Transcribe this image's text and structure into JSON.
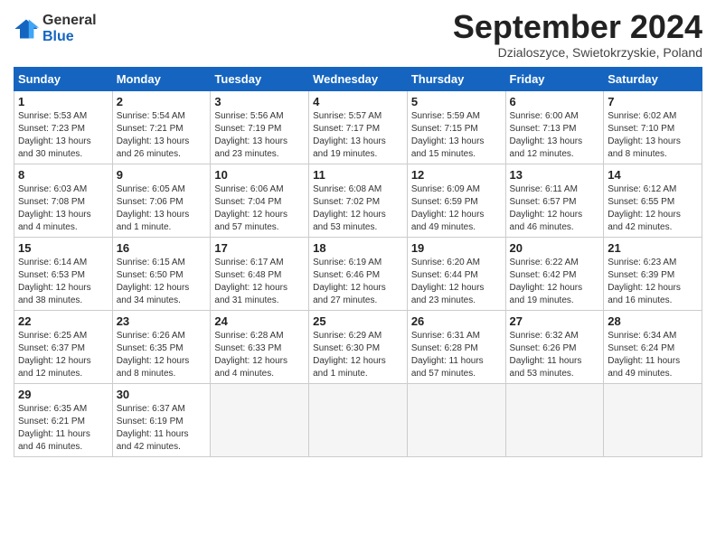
{
  "logo": {
    "general": "General",
    "blue": "Blue"
  },
  "title": "September 2024",
  "subtitle": "Dzialoszyce, Swietokrzyskie, Poland",
  "days_header": [
    "Sunday",
    "Monday",
    "Tuesday",
    "Wednesday",
    "Thursday",
    "Friday",
    "Saturday"
  ],
  "weeks": [
    [
      {
        "day": "1",
        "info": "Sunrise: 5:53 AM\nSunset: 7:23 PM\nDaylight: 13 hours\nand 30 minutes."
      },
      {
        "day": "2",
        "info": "Sunrise: 5:54 AM\nSunset: 7:21 PM\nDaylight: 13 hours\nand 26 minutes."
      },
      {
        "day": "3",
        "info": "Sunrise: 5:56 AM\nSunset: 7:19 PM\nDaylight: 13 hours\nand 23 minutes."
      },
      {
        "day": "4",
        "info": "Sunrise: 5:57 AM\nSunset: 7:17 PM\nDaylight: 13 hours\nand 19 minutes."
      },
      {
        "day": "5",
        "info": "Sunrise: 5:59 AM\nSunset: 7:15 PM\nDaylight: 13 hours\nand 15 minutes."
      },
      {
        "day": "6",
        "info": "Sunrise: 6:00 AM\nSunset: 7:13 PM\nDaylight: 13 hours\nand 12 minutes."
      },
      {
        "day": "7",
        "info": "Sunrise: 6:02 AM\nSunset: 7:10 PM\nDaylight: 13 hours\nand 8 minutes."
      }
    ],
    [
      {
        "day": "8",
        "info": "Sunrise: 6:03 AM\nSunset: 7:08 PM\nDaylight: 13 hours\nand 4 minutes."
      },
      {
        "day": "9",
        "info": "Sunrise: 6:05 AM\nSunset: 7:06 PM\nDaylight: 13 hours\nand 1 minute."
      },
      {
        "day": "10",
        "info": "Sunrise: 6:06 AM\nSunset: 7:04 PM\nDaylight: 12 hours\nand 57 minutes."
      },
      {
        "day": "11",
        "info": "Sunrise: 6:08 AM\nSunset: 7:02 PM\nDaylight: 12 hours\nand 53 minutes."
      },
      {
        "day": "12",
        "info": "Sunrise: 6:09 AM\nSunset: 6:59 PM\nDaylight: 12 hours\nand 49 minutes."
      },
      {
        "day": "13",
        "info": "Sunrise: 6:11 AM\nSunset: 6:57 PM\nDaylight: 12 hours\nand 46 minutes."
      },
      {
        "day": "14",
        "info": "Sunrise: 6:12 AM\nSunset: 6:55 PM\nDaylight: 12 hours\nand 42 minutes."
      }
    ],
    [
      {
        "day": "15",
        "info": "Sunrise: 6:14 AM\nSunset: 6:53 PM\nDaylight: 12 hours\nand 38 minutes."
      },
      {
        "day": "16",
        "info": "Sunrise: 6:15 AM\nSunset: 6:50 PM\nDaylight: 12 hours\nand 34 minutes."
      },
      {
        "day": "17",
        "info": "Sunrise: 6:17 AM\nSunset: 6:48 PM\nDaylight: 12 hours\nand 31 minutes."
      },
      {
        "day": "18",
        "info": "Sunrise: 6:19 AM\nSunset: 6:46 PM\nDaylight: 12 hours\nand 27 minutes."
      },
      {
        "day": "19",
        "info": "Sunrise: 6:20 AM\nSunset: 6:44 PM\nDaylight: 12 hours\nand 23 minutes."
      },
      {
        "day": "20",
        "info": "Sunrise: 6:22 AM\nSunset: 6:42 PM\nDaylight: 12 hours\nand 19 minutes."
      },
      {
        "day": "21",
        "info": "Sunrise: 6:23 AM\nSunset: 6:39 PM\nDaylight: 12 hours\nand 16 minutes."
      }
    ],
    [
      {
        "day": "22",
        "info": "Sunrise: 6:25 AM\nSunset: 6:37 PM\nDaylight: 12 hours\nand 12 minutes."
      },
      {
        "day": "23",
        "info": "Sunrise: 6:26 AM\nSunset: 6:35 PM\nDaylight: 12 hours\nand 8 minutes."
      },
      {
        "day": "24",
        "info": "Sunrise: 6:28 AM\nSunset: 6:33 PM\nDaylight: 12 hours\nand 4 minutes."
      },
      {
        "day": "25",
        "info": "Sunrise: 6:29 AM\nSunset: 6:30 PM\nDaylight: 12 hours\nand 1 minute."
      },
      {
        "day": "26",
        "info": "Sunrise: 6:31 AM\nSunset: 6:28 PM\nDaylight: 11 hours\nand 57 minutes."
      },
      {
        "day": "27",
        "info": "Sunrise: 6:32 AM\nSunset: 6:26 PM\nDaylight: 11 hours\nand 53 minutes."
      },
      {
        "day": "28",
        "info": "Sunrise: 6:34 AM\nSunset: 6:24 PM\nDaylight: 11 hours\nand 49 minutes."
      }
    ],
    [
      {
        "day": "29",
        "info": "Sunrise: 6:35 AM\nSunset: 6:21 PM\nDaylight: 11 hours\nand 46 minutes."
      },
      {
        "day": "30",
        "info": "Sunrise: 6:37 AM\nSunset: 6:19 PM\nDaylight: 11 hours\nand 42 minutes."
      },
      {
        "day": "",
        "info": ""
      },
      {
        "day": "",
        "info": ""
      },
      {
        "day": "",
        "info": ""
      },
      {
        "day": "",
        "info": ""
      },
      {
        "day": "",
        "info": ""
      }
    ]
  ]
}
